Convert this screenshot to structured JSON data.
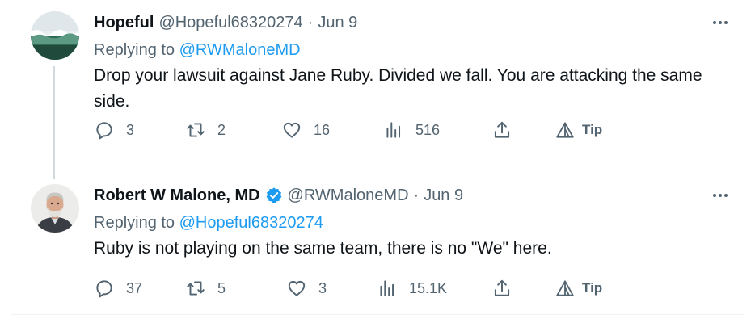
{
  "tweets": [
    {
      "name": "Hopeful",
      "handle": "@Hopeful68320274",
      "separator": "·",
      "date": "Jun 9",
      "replying_prefix": "Replying to",
      "replying_to": "@RWMaloneMD",
      "text": "Drop your lawsuit against Jane Ruby. Divided we fall. You are attacking the same side.",
      "verified": false,
      "stats": {
        "replies": "3",
        "retweets": "2",
        "likes": "16",
        "views": "516",
        "tip": "Tip"
      }
    },
    {
      "name": "Robert W Malone, MD",
      "handle": "@RWMaloneMD",
      "separator": "·",
      "date": "Jun 9",
      "replying_prefix": "Replying to",
      "replying_to": "@Hopeful68320274",
      "text": "Ruby is not playing on the same team, there is no \"We\" here.",
      "verified": true,
      "stats": {
        "replies": "37",
        "retweets": "5",
        "likes": "3",
        "views": "15.1K",
        "tip": "Tip"
      }
    }
  ],
  "colors": {
    "accent": "#1d9bf0",
    "secondary_text": "#536471",
    "primary_text": "#0f1419"
  },
  "icons": [
    "reply-icon",
    "retweet-icon",
    "like-icon",
    "views-icon",
    "share-icon",
    "tip-icon",
    "more-icon",
    "verified-badge-icon"
  ]
}
